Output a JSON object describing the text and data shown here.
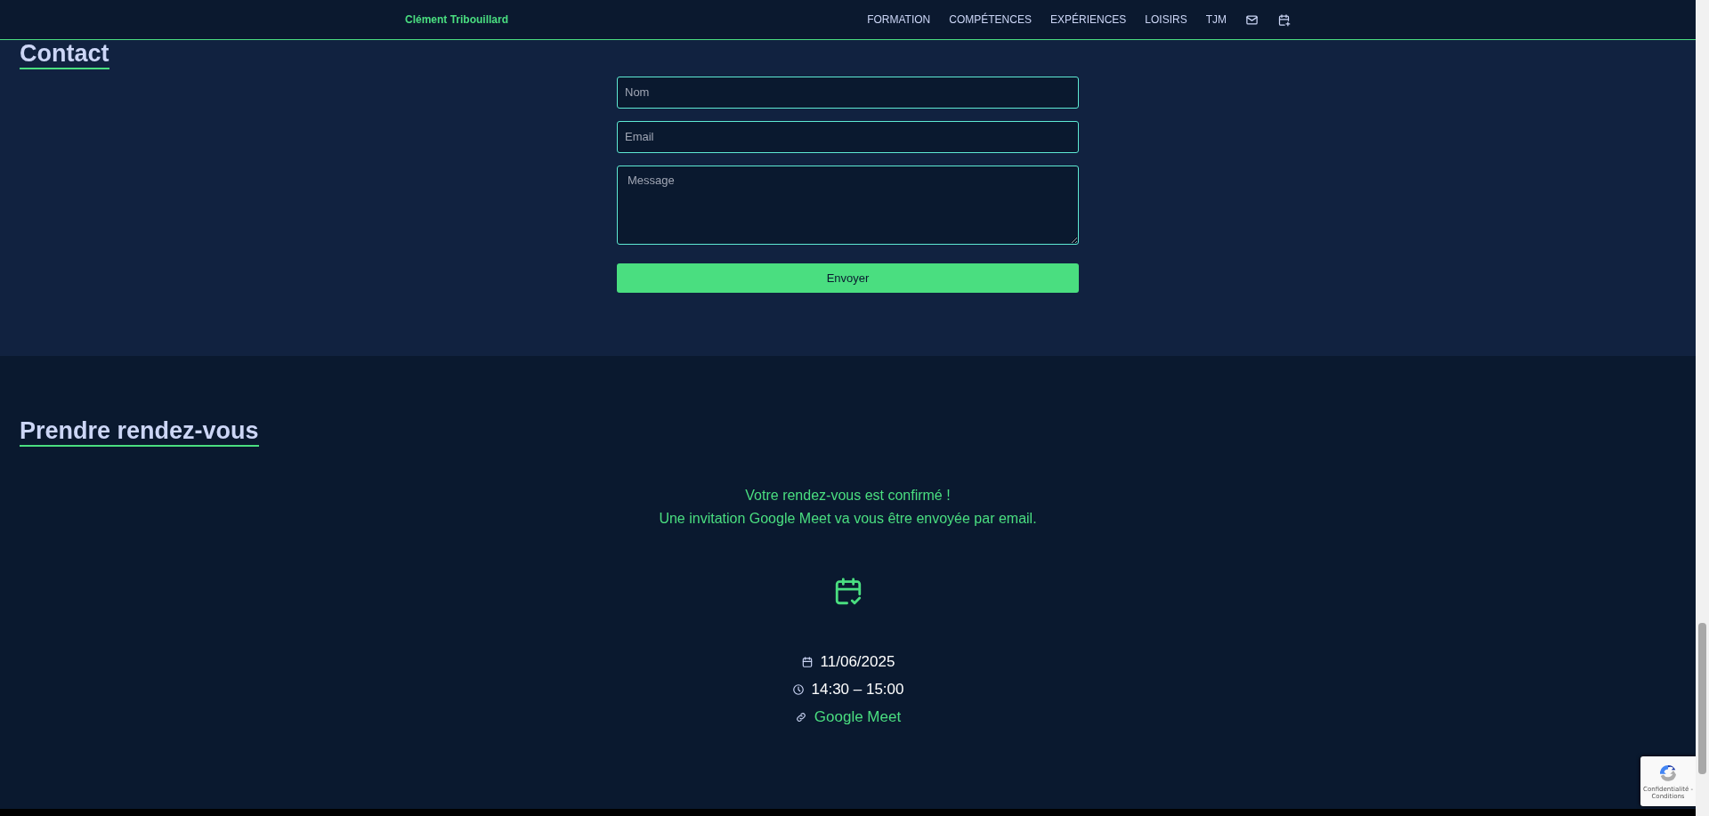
{
  "header": {
    "name": "Clément Tribouillard",
    "nav": [
      "FORMATION",
      "COMPÉTENCES",
      "EXPÉRIENCES",
      "LOISIRS",
      "TJM"
    ]
  },
  "contact": {
    "title": "Contact",
    "fields": [
      {
        "kind": "input",
        "placeholder": "Nom"
      },
      {
        "kind": "input",
        "placeholder": "Email"
      },
      {
        "kind": "textarea",
        "placeholder": "Message"
      }
    ],
    "submit": "Envoyer"
  },
  "booking": {
    "title": "Prendre rendez-vous",
    "confirmation": [
      "Votre rendez-vous est confirmé !",
      "Une invitation Google Meet va vous être envoyée par email."
    ],
    "details": [
      {
        "kind": "date",
        "text": "11/06/2025"
      },
      {
        "kind": "time",
        "text": "14:30 – 15:00"
      },
      {
        "kind": "link",
        "text": "Google Meet"
      }
    ]
  },
  "recaptcha": {
    "text": "Confidentialité - Conditions"
  }
}
